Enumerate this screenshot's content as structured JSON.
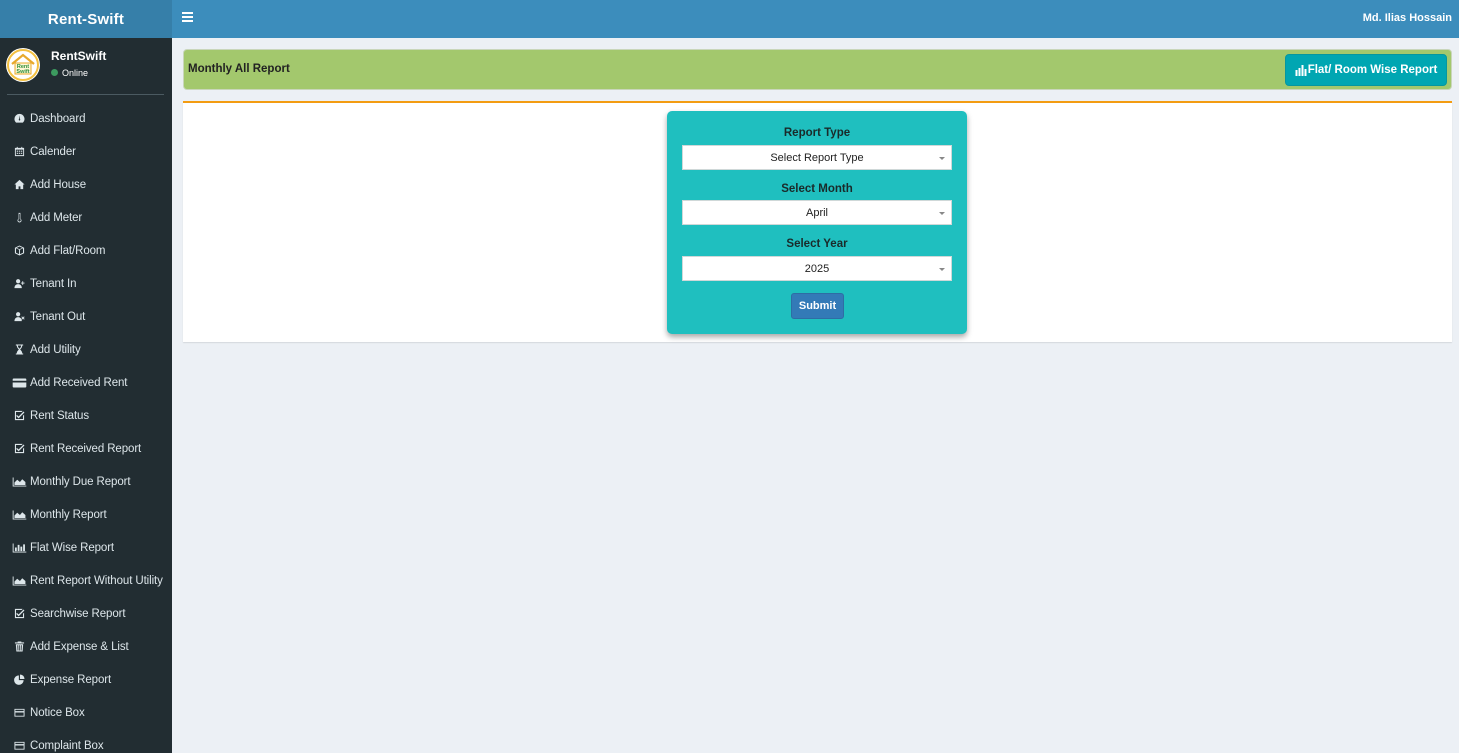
{
  "app": {
    "brand": "Rent-Swift"
  },
  "user_panel": {
    "name": "RentSwift",
    "status": "Online",
    "status_color": "#3c9a5f",
    "avatar_text_1": "Rent",
    "avatar_text_2": "Swift"
  },
  "topbar": {
    "user_name": "Md. Ilias Hossain"
  },
  "sidebar": {
    "items": [
      {
        "label": "Dashboard",
        "icon": "dashboard-icon"
      },
      {
        "label": "Calender",
        "icon": "calendar-icon"
      },
      {
        "label": "Add House",
        "icon": "home-icon"
      },
      {
        "label": "Add Meter",
        "icon": "thermometer-icon"
      },
      {
        "label": "Add Flat/Room",
        "icon": "cube-icon"
      },
      {
        "label": "Tenant In",
        "icon": "user-plus-icon"
      },
      {
        "label": "Tenant Out",
        "icon": "user-times-icon"
      },
      {
        "label": "Add Utility",
        "icon": "hourglass-icon"
      },
      {
        "label": "Add Received Rent",
        "icon": "credit-card-icon"
      },
      {
        "label": "Rent Status",
        "icon": "check-square-icon"
      },
      {
        "label": "Rent Received Report",
        "icon": "check-square-icon"
      },
      {
        "label": "Monthly Due Report",
        "icon": "area-chart-icon"
      },
      {
        "label": "Monthly Report",
        "icon": "area-chart-icon"
      },
      {
        "label": "Flat Wise Report",
        "icon": "bar-chart-icon"
      },
      {
        "label": "Rent Report Without Utility",
        "icon": "area-chart-icon"
      },
      {
        "label": "Searchwise Report",
        "icon": "check-square-icon"
      },
      {
        "label": "Add Expense & List",
        "icon": "trash-icon"
      },
      {
        "label": "Expense Report",
        "icon": "pie-chart-icon"
      },
      {
        "label": "Notice Box",
        "icon": "card-icon"
      },
      {
        "label": "Complaint Box",
        "icon": "card-icon"
      }
    ]
  },
  "header": {
    "title": "Monthly All Report",
    "button_label": "Flat/ Room Wise Report"
  },
  "form": {
    "report_type_label": "Report Type",
    "report_type_value": "Select Report Type",
    "month_label": "Select Month",
    "month_value": "April",
    "year_label": "Select Year",
    "year_value": "2025",
    "submit_label": "Submit"
  },
  "colors": {
    "sidebar": "#222d32",
    "topbar": "#3c8dbc",
    "header_bar": "#a3c86d",
    "form_card": "#1fbfbf",
    "box_accent": "#f39c12",
    "submit": "#337ab7"
  }
}
